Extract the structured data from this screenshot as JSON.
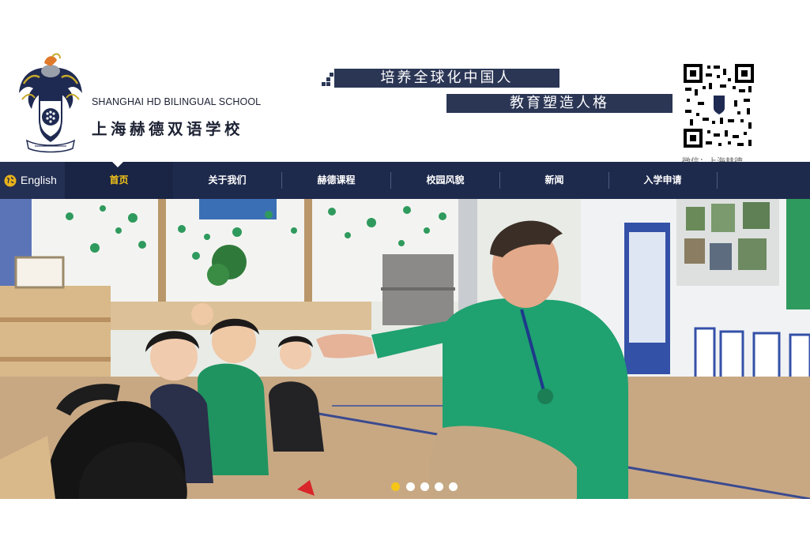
{
  "header": {
    "school_name_en": "SHANGHAI HD BILINGUAL SCHOOL",
    "school_name_cn": "上海赫德双语学校",
    "crest_icon": "school-crest-icon",
    "slogan_1": "培养全球化中国人",
    "slogan_2": "教育塑造人格",
    "qr_caption": "微信：上海赫德"
  },
  "nav": {
    "language_label": "English",
    "globe_icon": "globe-icon",
    "items": [
      {
        "label": "首页",
        "active": true
      },
      {
        "label": "关于我们",
        "active": false
      },
      {
        "label": "赫德课程",
        "active": false
      },
      {
        "label": "校园风貌",
        "active": false
      },
      {
        "label": "新闻",
        "active": false
      },
      {
        "label": "入学申请",
        "active": false
      }
    ]
  },
  "hero": {
    "slide_count": 5,
    "active_slide": 1
  },
  "colors": {
    "navy": "#1e2a4c",
    "slogan_bar": "#2b3655",
    "accent_yellow": "#f5c518",
    "sweater_green": "#1fa170"
  }
}
